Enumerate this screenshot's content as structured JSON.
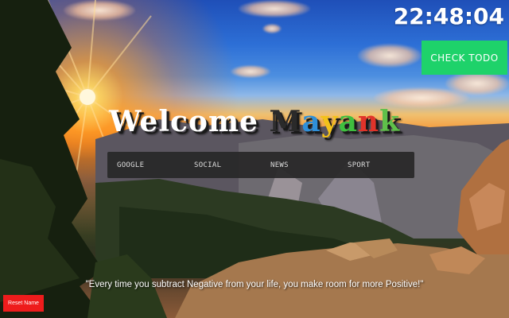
{
  "clock": {
    "time": "22:48:04"
  },
  "todo_button": {
    "label": "CHECK TODO"
  },
  "greeting": {
    "prefix": "Welcome ",
    "name_letters": [
      {
        "ch": "M",
        "color": "#2a2a2a"
      },
      {
        "ch": "a",
        "color": "#2f8fd8"
      },
      {
        "ch": "y",
        "color": "#f3c21a"
      },
      {
        "ch": "a",
        "color": "#3fbf3f"
      },
      {
        "ch": "n",
        "color": "#e0332a"
      },
      {
        "ch": "k",
        "color": "#5fc04a"
      }
    ]
  },
  "nav": {
    "items": [
      {
        "label": "GOOGLE"
      },
      {
        "label": "SOCIAL"
      },
      {
        "label": "NEWS"
      },
      {
        "label": "SPORT"
      }
    ]
  },
  "quote": {
    "text": "\"Every time you subtract Negative from your life, you make room for more Positive!\""
  },
  "reset_button": {
    "label": "Reset Name"
  },
  "colors": {
    "todo_green": "#1ed26a",
    "reset_red": "#ee1c1c",
    "nav_bg": "#282828"
  },
  "background": {
    "scene": "mountain-sunset-wallpaper"
  }
}
